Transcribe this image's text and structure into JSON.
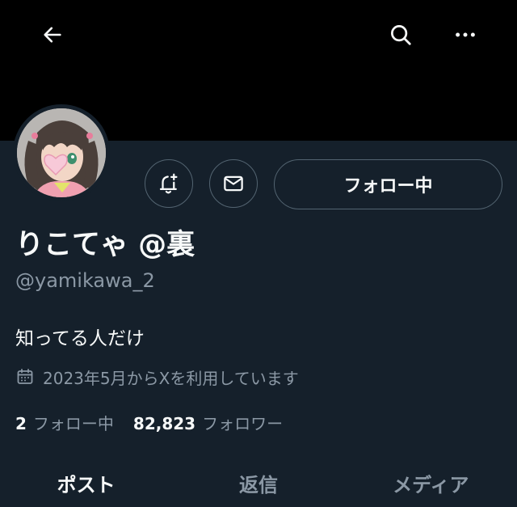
{
  "header": {
    "back_icon": "arrow-left-icon",
    "search_icon": "search-icon",
    "more_icon": "more-horizontal-icon"
  },
  "profile": {
    "name": "りこてゃ @裏",
    "handle": "@yamikawa_2",
    "bio": "知ってる人だけ",
    "joined": "2023年5月からXを利用しています",
    "joined_icon": "calendar-icon"
  },
  "actions": {
    "notify_icon": "bell-plus-icon",
    "message_icon": "mail-icon",
    "follow_label": "フォロー中"
  },
  "stats": {
    "following_count": "2",
    "following_label": "フォロー中",
    "followers_count": "82,823",
    "followers_label": "フォロワー"
  },
  "tabs": [
    {
      "label": "ポスト",
      "active": true
    },
    {
      "label": "返信",
      "active": false
    },
    {
      "label": "メディア",
      "active": false
    }
  ],
  "colors": {
    "background": "#15202b",
    "banner": "#000000",
    "text_primary": "#f7f9f9",
    "text_secondary": "#8b98a5",
    "border": "#536471"
  }
}
